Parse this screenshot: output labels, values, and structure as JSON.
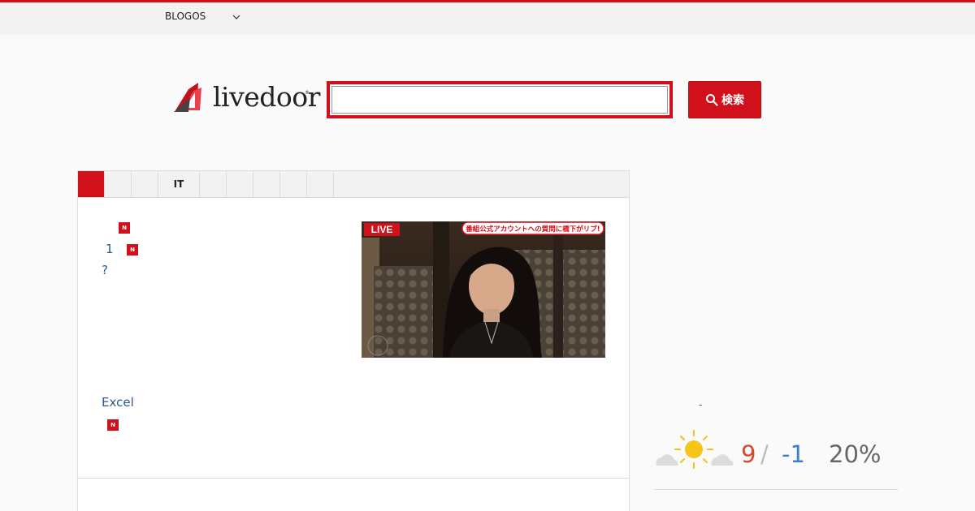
{
  "header": {
    "blogos_label": "BLOGOS",
    "chevron_icon": "chevron-down-icon"
  },
  "logo": {
    "text": "livedoor",
    "registered": "®"
  },
  "search": {
    "value": "",
    "placeholder": "",
    "button_label": "検索",
    "button_icon": "search-icon"
  },
  "tabs": [
    {
      "label": "",
      "active": true
    },
    {
      "label": ""
    },
    {
      "label": ""
    },
    {
      "label": "IT"
    },
    {
      "label": ""
    },
    {
      "label": ""
    },
    {
      "label": ""
    },
    {
      "label": ""
    },
    {
      "label": ""
    }
  ],
  "news": {
    "items": [
      {
        "text": "",
        "new": true
      },
      {
        "text": "1",
        "new": true
      },
      {
        "text": "?",
        "new": false
      },
      {
        "text": "Excel",
        "new": false
      },
      {
        "text": "",
        "new": true
      }
    ],
    "new_badge": "N",
    "thumbnail": {
      "live_label": "LIVE",
      "caption": "番組公式アカウントへの質問に橋下がリプ!"
    }
  },
  "weather": {
    "link": "-",
    "icon": "sun-with-clouds-icon",
    "high": "9",
    "separator": "/",
    "low": "-1",
    "rain": "20%"
  },
  "colors": {
    "brand": "#d0111b",
    "link": "#2a5a8c",
    "high_temp": "#d54a2b",
    "low_temp": "#3b7fcf"
  }
}
